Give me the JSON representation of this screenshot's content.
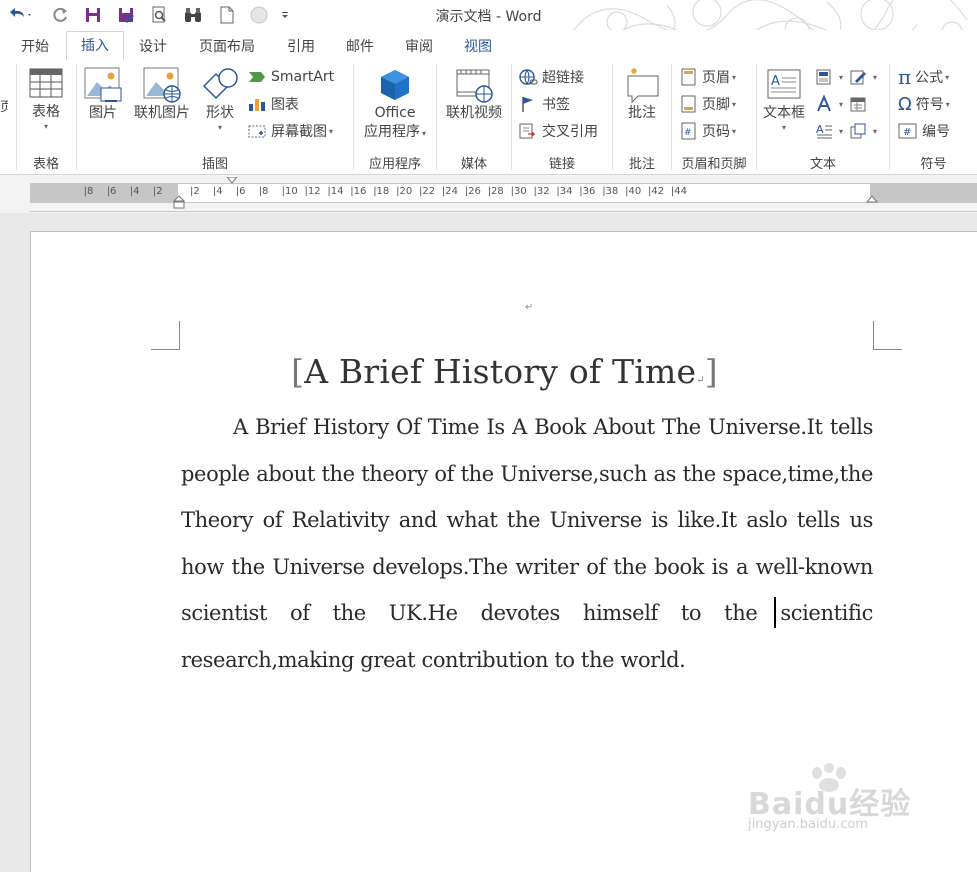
{
  "window": {
    "title": "演示文档 - Word"
  },
  "tabs": [
    {
      "label": "开始"
    },
    {
      "label": "插入"
    },
    {
      "label": "设计"
    },
    {
      "label": "页面布局"
    },
    {
      "label": "引用"
    },
    {
      "label": "邮件"
    },
    {
      "label": "审阅"
    },
    {
      "label": "视图"
    }
  ],
  "active_tab": "插入",
  "ribbon": {
    "groups": {
      "table": {
        "label": "表格",
        "button": "表格"
      },
      "illustrations": {
        "label": "插图",
        "picture": "图片",
        "online_picture": "联机图片",
        "shapes": "形状",
        "smartart": "SmartArt",
        "chart": "图表",
        "screenshot": "屏幕截图"
      },
      "apps": {
        "label": "应用程序",
        "button_line1": "Office",
        "button_line2": "应用程序"
      },
      "media": {
        "label": "媒体",
        "button": "联机视频"
      },
      "links": {
        "label": "链接",
        "hyperlink": "超链接",
        "bookmark": "书签",
        "cross_ref": "交叉引用"
      },
      "comments": {
        "label": "批注",
        "button": "批注"
      },
      "header_footer": {
        "label": "页眉和页脚",
        "header": "页眉",
        "footer": "页脚",
        "page_number": "页码"
      },
      "text": {
        "label": "文本",
        "textbox": "文本框"
      },
      "symbols": {
        "label": "符号",
        "equation": "公式",
        "symbol": "符号",
        "number": "编号"
      }
    }
  },
  "ruler": {
    "left_numbers": [
      "8",
      "6",
      "4",
      "2"
    ],
    "right_numbers": [
      "2",
      "4",
      "6",
      "8",
      "10",
      "12",
      "14",
      "16",
      "18",
      "20",
      "22",
      "24",
      "26",
      "28",
      "30",
      "32",
      "34",
      "36",
      "38",
      "40",
      "42",
      "44"
    ]
  },
  "document": {
    "title": "A Brief History of Time",
    "body": "A Brief History Of Time Is A Book About The Universe.It tells people about the theory of the Universe,such as the space,time,the Theory of Relativity and what the Universe is like.It aslo tells us how the Universe develops.The writer of the book is a well-known scientist of the UK.He devotes himself to the scientific research,making great contribution to the world."
  },
  "watermark": {
    "logo_text": "Baidu经验",
    "url": "jingyan.baidu.com"
  },
  "colors": {
    "accent": "#2b579a",
    "ruler_gray": "#c6c6c6",
    "page": "#ffffff",
    "canvas": "#e8e8e8"
  }
}
